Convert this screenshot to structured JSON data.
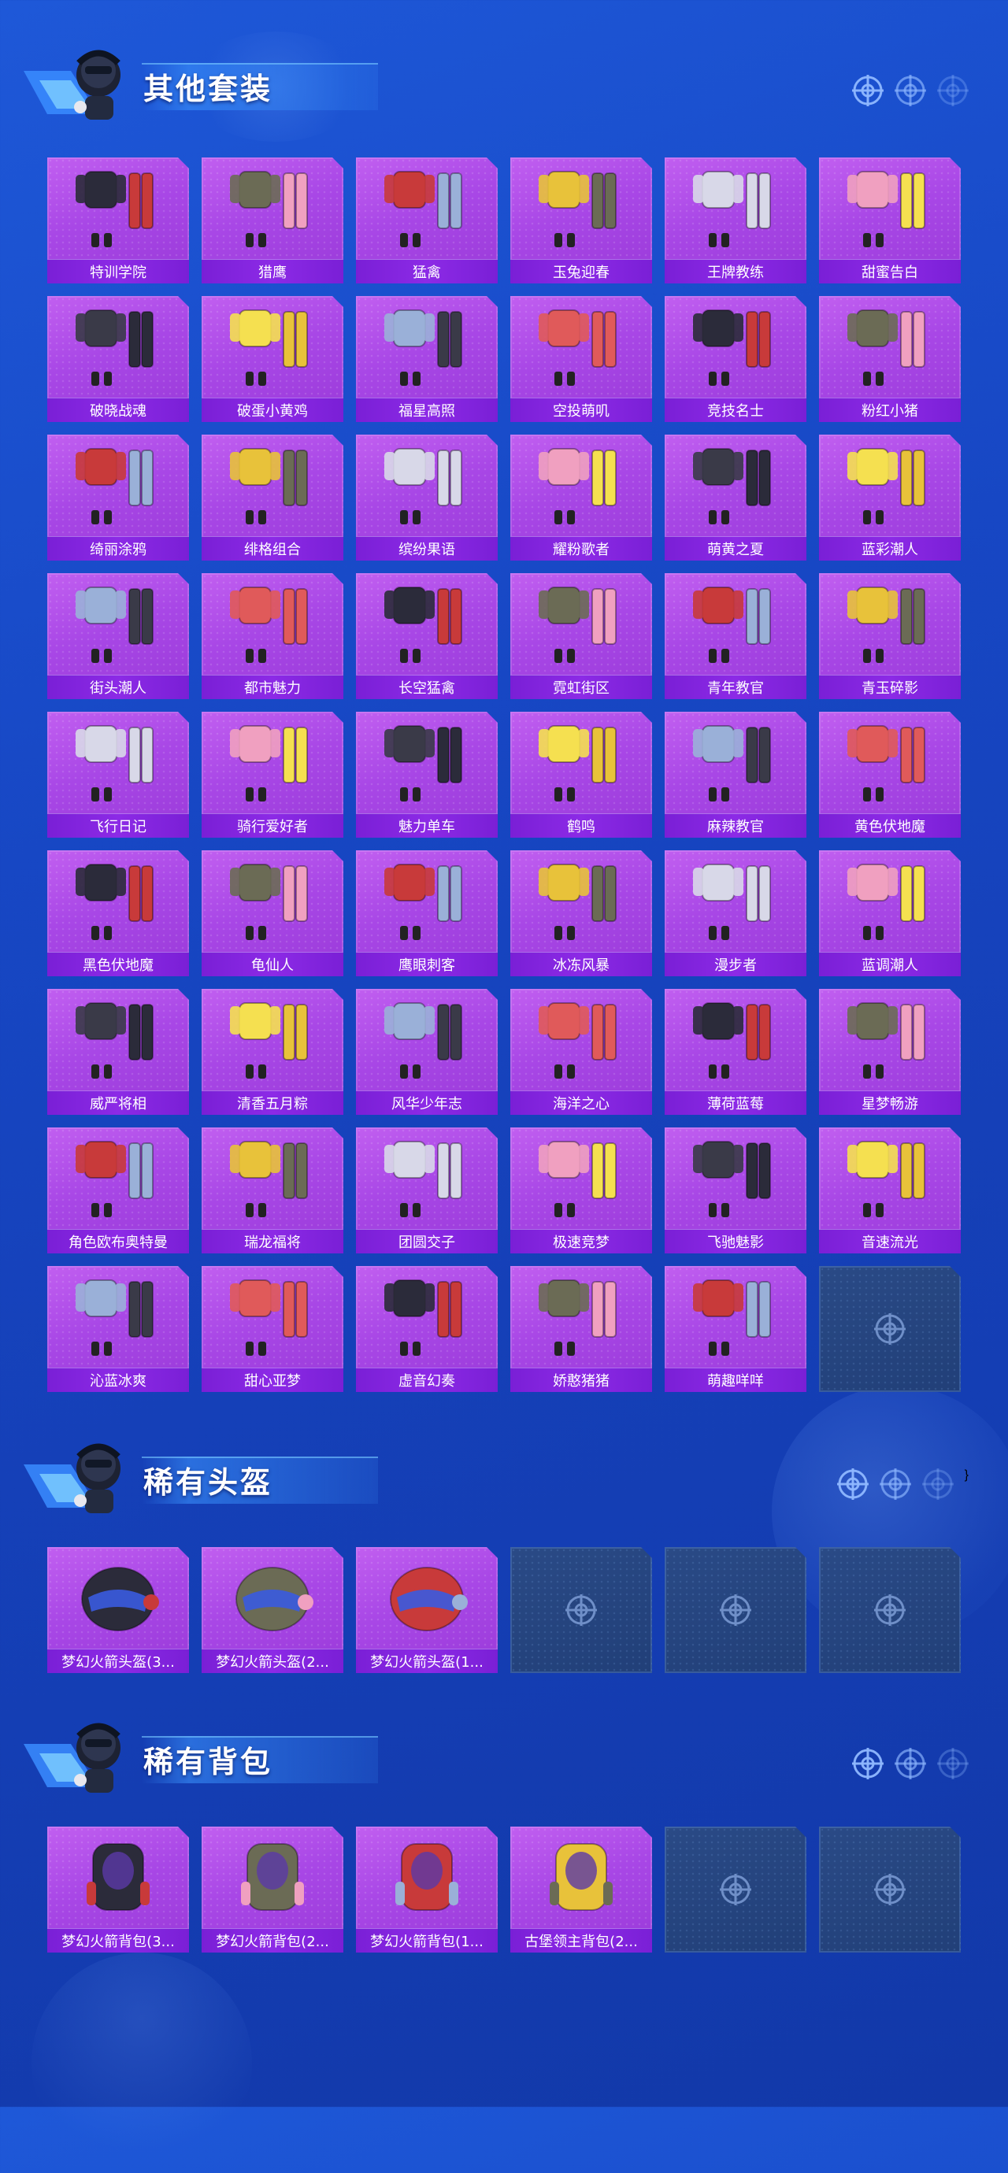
{
  "colors": {
    "background": "#1747c4",
    "card_purple": "#a847e6",
    "label_bar": "#7a1fd6",
    "empty_card": "#213f78"
  },
  "sections": [
    {
      "title": "其他套装",
      "icon": "mascot-icon",
      "items": [
        {
          "label": "特训学院"
        },
        {
          "label": "猎鹰"
        },
        {
          "label": "猛禽"
        },
        {
          "label": "玉兔迎春"
        },
        {
          "label": "王牌教练"
        },
        {
          "label": "甜蜜告白"
        },
        {
          "label": "破晓战魂"
        },
        {
          "label": "破蛋小黄鸡"
        },
        {
          "label": "福星高照"
        },
        {
          "label": "空投萌叽"
        },
        {
          "label": "竞技名士"
        },
        {
          "label": "粉红小猪"
        },
        {
          "label": "绮丽涂鸦"
        },
        {
          "label": "绯格组合"
        },
        {
          "label": "缤纷果语"
        },
        {
          "label": "耀粉歌者"
        },
        {
          "label": "萌黄之夏"
        },
        {
          "label": "蓝彩潮人"
        },
        {
          "label": "街头潮人"
        },
        {
          "label": "都市魅力"
        },
        {
          "label": "长空猛禽"
        },
        {
          "label": "霓虹街区"
        },
        {
          "label": "青年教官"
        },
        {
          "label": "青玉碎影"
        },
        {
          "label": "飞行日记"
        },
        {
          "label": "骑行爱好者"
        },
        {
          "label": "魅力单车"
        },
        {
          "label": "鹤鸣"
        },
        {
          "label": "麻辣教官"
        },
        {
          "label": "黄色伏地魔"
        },
        {
          "label": "黑色伏地魔"
        },
        {
          "label": "龟仙人"
        },
        {
          "label": "鹰眼刺客"
        },
        {
          "label": "冰冻风暴"
        },
        {
          "label": "漫步者"
        },
        {
          "label": "蓝调潮人"
        },
        {
          "label": "威严将相"
        },
        {
          "label": "清香五月粽"
        },
        {
          "label": "风华少年志"
        },
        {
          "label": "海洋之心"
        },
        {
          "label": "薄荷蓝莓"
        },
        {
          "label": "星梦畅游"
        },
        {
          "label": "角色欧布奥特曼"
        },
        {
          "label": "瑞龙福将"
        },
        {
          "label": "团圆交子"
        },
        {
          "label": "极速竞梦"
        },
        {
          "label": "飞驰魅影"
        },
        {
          "label": "音速流光"
        },
        {
          "label": "沁蓝冰爽"
        },
        {
          "label": "甜心亚梦"
        },
        {
          "label": "虚音幻奏"
        },
        {
          "label": "娇憨猪猪"
        },
        {
          "label": "萌趣咩咩"
        },
        {
          "label": ""
        }
      ],
      "empty_slots": 1
    },
    {
      "title": "稀有头盔",
      "icon": "mascot-icon",
      "items": [
        {
          "label": "梦幻火箭头盔(3..."
        },
        {
          "label": "梦幻火箭头盔(2..."
        },
        {
          "label": "梦幻火箭头盔(1..."
        }
      ],
      "empty_slots": 3
    },
    {
      "title": "稀有背包",
      "icon": "mascot-icon",
      "items": [
        {
          "label": "梦幻火箭背包(3..."
        },
        {
          "label": "梦幻火箭背包(2..."
        },
        {
          "label": "梦幻火箭背包(1..."
        },
        {
          "label": "古堡领主背包(2..."
        }
      ],
      "empty_slots": 2
    }
  ]
}
